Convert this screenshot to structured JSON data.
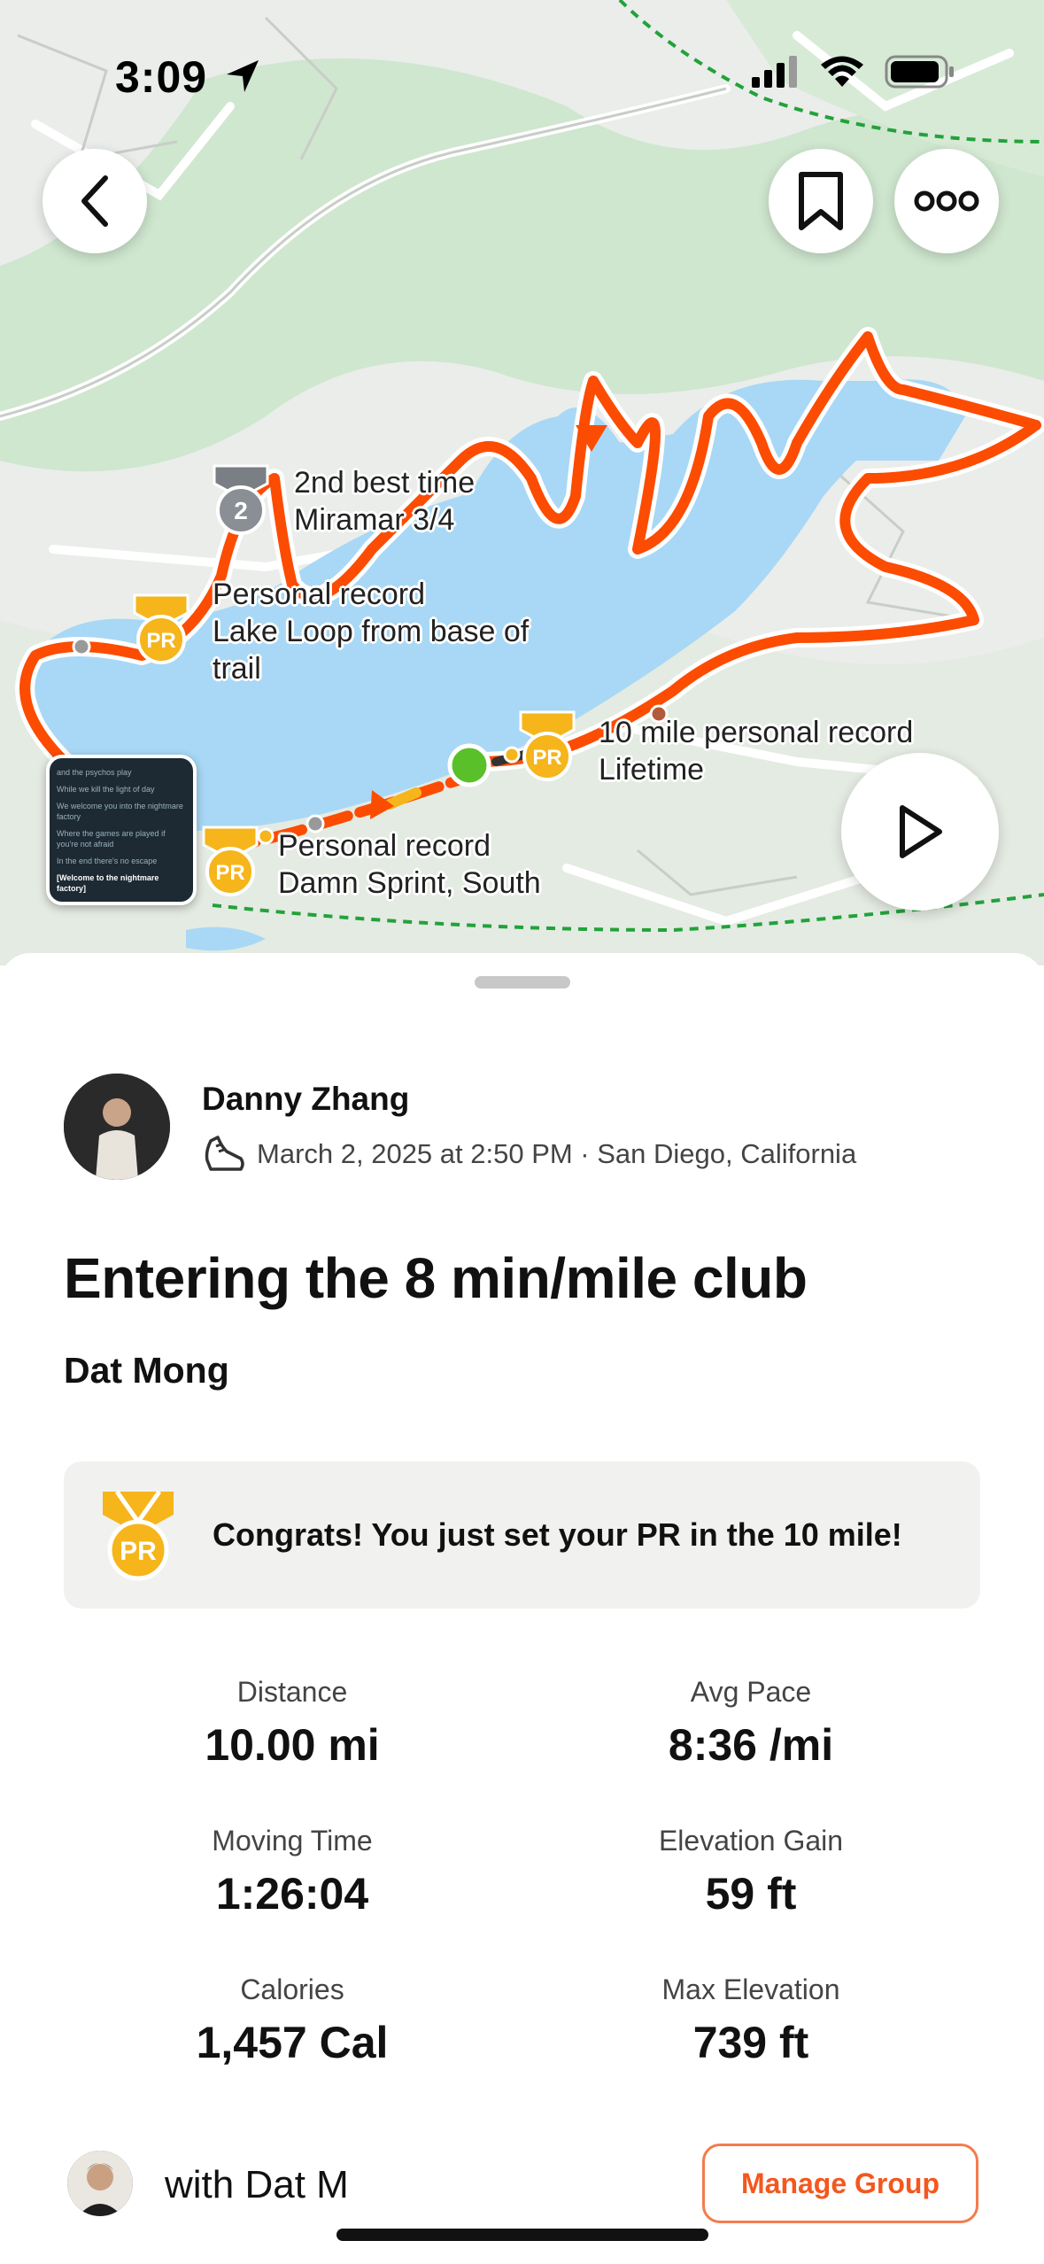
{
  "status_bar": {
    "time": "3:09"
  },
  "map": {
    "labels": [
      {
        "line1": "2nd best time",
        "line2": "Miramar 3/4"
      },
      {
        "line1": "Personal record",
        "line2": "Lake Loop from base of",
        "line3": "trail"
      },
      {
        "line1": "10 mile personal record",
        "line2": "Lifetime"
      },
      {
        "line1": "Personal record",
        "line2": "Damn Sprint, South"
      }
    ],
    "badges": {
      "pr": "PR",
      "second": "2"
    },
    "media_thumbnail_lines": [
      "and the psychos play",
      "While we kill the light of day",
      "We welcome you into the nightmare factory",
      "Where the games are played if you're not afraid",
      "In the end there's no escape",
      "[Welcome to the nightmare factory]"
    ],
    "route_color": "#fc4c02",
    "water_color": "#a8d8f5"
  },
  "activity": {
    "athlete_name": "Danny Zhang",
    "meta": "March 2, 2025 at 2:50 PM · San Diego, California",
    "title": "Entering the 8 min/mile club",
    "subtitle": "Dat Mong",
    "pr_banner": {
      "badge": "PR",
      "text": "Congrats! You just set your PR in the 10 mile!"
    },
    "stats": [
      {
        "label": "Distance",
        "value": "10.00 mi"
      },
      {
        "label": "Avg Pace",
        "value": "8:36 /mi"
      },
      {
        "label": "Moving Time",
        "value": "1:26:04"
      },
      {
        "label": "Elevation Gain",
        "value": "59 ft"
      },
      {
        "label": "Calories",
        "value": "1,457 Cal"
      },
      {
        "label": "Max Elevation",
        "value": "739 ft"
      }
    ],
    "group": {
      "with_text": "with Dat M",
      "manage_label": "Manage Group"
    }
  },
  "colors": {
    "accent": "#fc4c02",
    "pr_gold": "#f5b51b",
    "banner_bg": "#f1f1f0"
  }
}
